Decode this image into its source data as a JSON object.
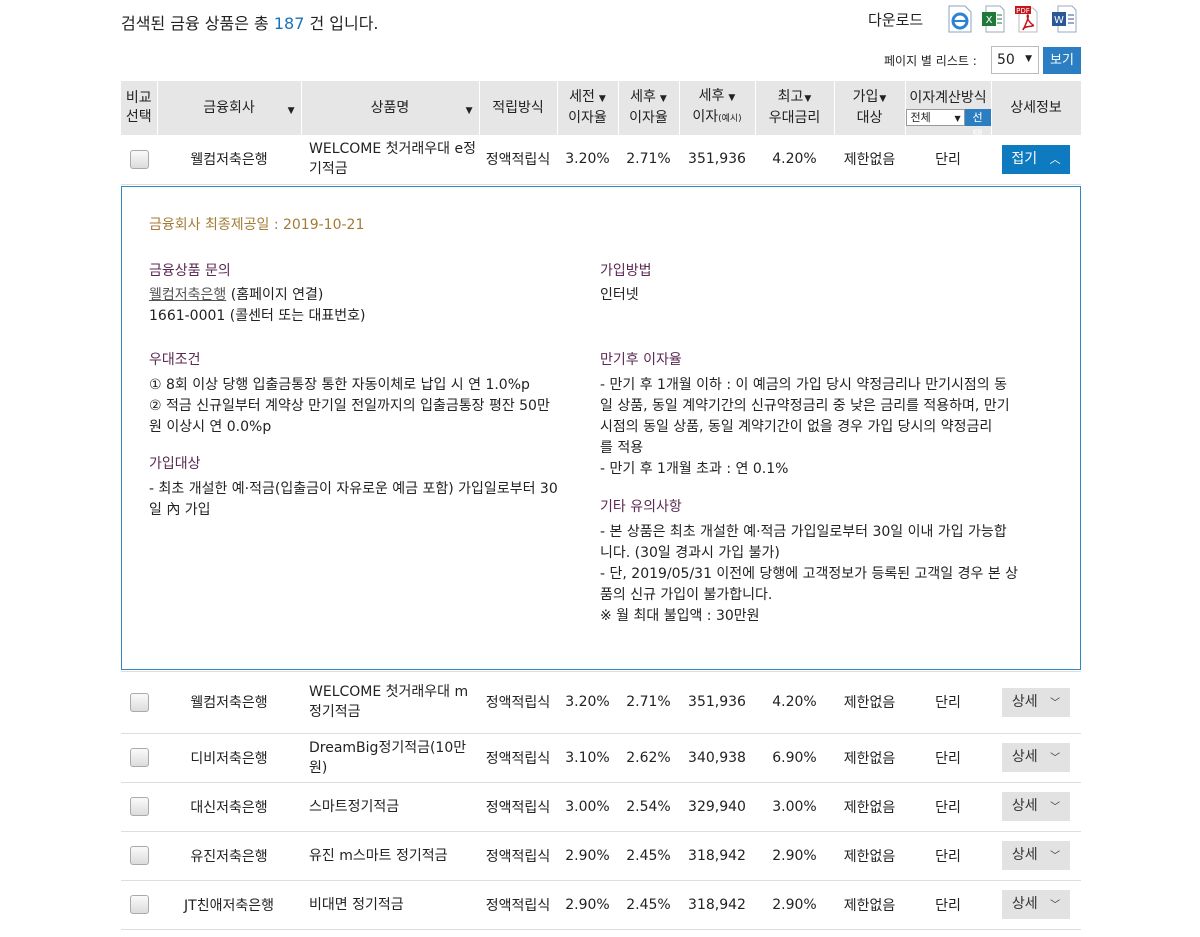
{
  "summary": {
    "prefix": "검색된 금융 상품은 총 ",
    "count": "187",
    "suffix": " 건 입니다."
  },
  "download": {
    "label": "다운로드",
    "icons": [
      "ie-icon",
      "excel-icon",
      "pdf-icon",
      "word-icon"
    ],
    "pdf_text": "PDF"
  },
  "pagination": {
    "label": "페이지 별 리스트 :",
    "value": "50",
    "button": "보기"
  },
  "headers": {
    "compare": [
      "비교",
      "선택"
    ],
    "company": "금융회사",
    "product": "상품명",
    "method": "적립방식",
    "pretax": [
      "세전",
      "이자율"
    ],
    "aftertax": [
      "세후",
      "이자율"
    ],
    "interest": [
      "세후",
      "이자",
      "(예시)"
    ],
    "max_rate": [
      "최고",
      "우대금리"
    ],
    "target": [
      "가입",
      "대상"
    ],
    "calc": {
      "label": "이자계산방식",
      "select": "전체",
      "button": "선택"
    },
    "info": "상세정보"
  },
  "rows": [
    {
      "company": "웰컴저축은행",
      "product": "WELCOME 첫거래우대 e정기적금",
      "method": "정액적립식",
      "pretax": "3.20%",
      "aftertax": "2.71%",
      "interest": "351,936",
      "max": "4.20%",
      "target": "제한없음",
      "calc": "단리",
      "button": "접기"
    },
    {
      "company": "웰컴저축은행",
      "product": "WELCOME 첫거래우대 m정기적금",
      "method": "정액적립식",
      "pretax": "3.20%",
      "aftertax": "2.71%",
      "interest": "351,936",
      "max": "4.20%",
      "target": "제한없음",
      "calc": "단리",
      "button": "상세"
    },
    {
      "company": "디비저축은행",
      "product": "DreamBig정기적금(10만원)",
      "method": "정액적립식",
      "pretax": "3.10%",
      "aftertax": "2.62%",
      "interest": "340,938",
      "max": "6.90%",
      "target": "제한없음",
      "calc": "단리",
      "button": "상세"
    },
    {
      "company": "대신저축은행",
      "product": "스마트정기적금",
      "method": "정액적립식",
      "pretax": "3.00%",
      "aftertax": "2.54%",
      "interest": "329,940",
      "max": "3.00%",
      "target": "제한없음",
      "calc": "단리",
      "button": "상세"
    },
    {
      "company": "유진저축은행",
      "product": "유진 m스마트 정기적금",
      "method": "정액적립식",
      "pretax": "2.90%",
      "aftertax": "2.45%",
      "interest": "318,942",
      "max": "2.90%",
      "target": "제한없음",
      "calc": "단리",
      "button": "상세"
    },
    {
      "company": "JT친애저축은행",
      "product": "비대면 정기적금",
      "method": "정액적립식",
      "pretax": "2.90%",
      "aftertax": "2.45%",
      "interest": "318,942",
      "max": "2.90%",
      "target": "제한없음",
      "calc": "단리",
      "button": "상세"
    }
  ],
  "detail": {
    "date": "금융회사 최종제공일 : 2019-10-21",
    "inquiry_title": "금융상품 문의",
    "inquiry_link": "웰컴저축은행",
    "inquiry_link_suffix": " (홈페이지 연결)",
    "inquiry_phone": "1661-0001 (콜센터 또는 대표번호)",
    "join_method_title": "가입방법",
    "join_method": "인터넷",
    "pref_title": "우대조건",
    "pref_lines": [
      "① 8회 이상 당행 입출금통장 통한 자동이체로 납입 시 연 1.0%p",
      "② 적금 신규일부터 계약상 만기일 전일까지의 입출금통장 평잔 50만",
      "원 이상시 연 0.0%p"
    ],
    "target_title": "가입대상",
    "target_lines": [
      "- 최초 개설한 예·적금(입출금이 자유로운 예금 포함) 가입일로부터 30",
      "일 內 가입"
    ],
    "maturity_title": "만기후 이자율",
    "maturity_lines": [
      "- 만기 후 1개월 이하 : 이 예금의 가입 당시 약정금리나 만기시점의 동",
      "일 상품, 동일 계약기간의 신규약정금리 중 낮은 금리를 적용하며, 만기",
      "시점의 동일 상품, 동일 계약기간이 없을 경우 가입 당시의 약정금리",
      "를 적용",
      "- 만기 후 1개월 초과 : 연 0.1%"
    ],
    "notes_title": "기타 유의사항",
    "notes_lines": [
      "- 본 상품은 최초 개설한 예·적금 가입일로부터 30일 이내 가입 가능합",
      "니다. (30일 경과시 가입 불가)",
      "- 단, 2019/05/31 이전에 당행에 고객정보가 등록된 고객일 경우 본 상",
      "품의 신규 가입이 불가합니다.",
      "※ 월 최대 불입액 : 30만원"
    ]
  }
}
